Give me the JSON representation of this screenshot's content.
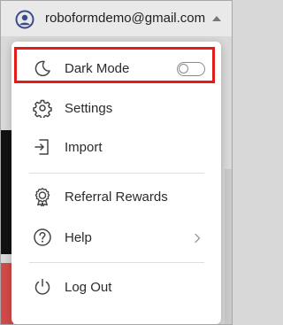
{
  "account": {
    "email": "roboformdemo@gmail.com",
    "icon": "user-circle-icon"
  },
  "menu": {
    "dark_mode": {
      "label": "Dark Mode",
      "icon": "moon-icon",
      "enabled": false
    },
    "settings": {
      "label": "Settings",
      "icon": "gear-icon"
    },
    "import": {
      "label": "Import",
      "icon": "import-icon"
    },
    "referral": {
      "label": "Referral Rewards",
      "icon": "award-icon"
    },
    "help": {
      "label": "Help",
      "icon": "question-circle-icon",
      "submenu_icon": "chevron-right-icon"
    },
    "logout": {
      "label": "Log Out",
      "icon": "power-icon"
    }
  },
  "colors": {
    "highlight": "#e21b1b",
    "account_icon": "#3a4a8c"
  }
}
